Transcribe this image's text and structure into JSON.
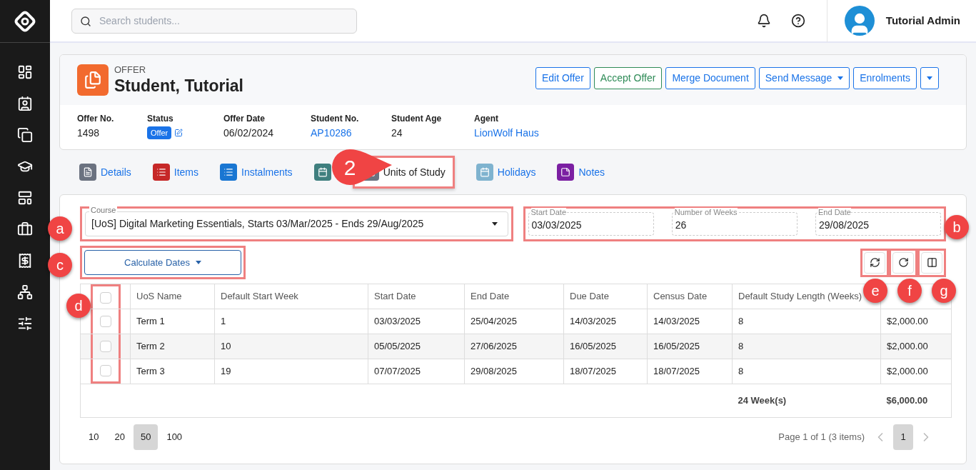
{
  "search": {
    "placeholder": "Search students..."
  },
  "user": {
    "name": "Tutorial Admin"
  },
  "offer": {
    "kind_label": "OFFER",
    "title": "Student, Tutorial",
    "actions": [
      {
        "label": "Edit Offer",
        "kind": "primary"
      },
      {
        "label": "Accept Offer",
        "kind": "success"
      },
      {
        "label": "Merge Document",
        "kind": "primary"
      },
      {
        "label": "Send Message",
        "kind": "dropdown"
      },
      {
        "label": "Enrolments",
        "kind": "primary"
      },
      {
        "kind": "caret"
      }
    ],
    "fields": [
      {
        "label": "Offer No.",
        "value": "1498",
        "kind": "text"
      },
      {
        "label": "Status",
        "value": "Offer",
        "kind": "badge"
      },
      {
        "label": "Offer Date",
        "value": "06/02/2024",
        "kind": "text"
      },
      {
        "label": "Student No.",
        "value": "AP10286",
        "kind": "link"
      },
      {
        "label": "Student Age",
        "value": "24",
        "kind": "text"
      },
      {
        "label": "Agent",
        "value": "LionWolf Haus",
        "kind": "link"
      }
    ]
  },
  "tabs": [
    {
      "label": "Details",
      "color": "#6b7280",
      "selected": false
    },
    {
      "label": "Items",
      "color": "#c62828",
      "selected": false
    },
    {
      "label": "Instalments",
      "color": "#1976d2",
      "selected": false
    },
    {
      "color": "#3f7f7f",
      "selected": false
    },
    {
      "label": "Units of Study",
      "color": "#6b7280",
      "selected": true
    },
    {
      "label": "Holidays",
      "color": "#7fb3cf",
      "selected": false
    },
    {
      "label": "Notes",
      "color": "#7b1fa2",
      "selected": false
    }
  ],
  "course": {
    "label": "Course",
    "value": "[UoS] Digital Marketing Essentials, Starts 03/Mar/2025 - Ends 29/Aug/2025"
  },
  "date_fields": [
    {
      "label": "Start Date",
      "value": "03/03/2025"
    },
    {
      "label": "Number of Weeks",
      "value": "26"
    },
    {
      "label": "End Date",
      "value": "29/08/2025"
    }
  ],
  "calculate_button": {
    "label": "Calculate Dates"
  },
  "table": {
    "header_checked": false,
    "columns": [
      "UoS Name",
      "Default Start Week",
      "Start Date",
      "End Date",
      "Due Date",
      "Census Date",
      "Default Study Length (Weeks)"
    ],
    "rows": [
      {
        "checked": false,
        "cells": [
          "Term 1",
          "1",
          "03/03/2025",
          "25/04/2025",
          "14/03/2025",
          "14/03/2025",
          "8",
          "$2,000.00"
        ]
      },
      {
        "checked": false,
        "cells": [
          "Term 2",
          "10",
          "05/05/2025",
          "27/06/2025",
          "16/05/2025",
          "16/05/2025",
          "8",
          "$2,000.00"
        ]
      },
      {
        "checked": false,
        "cells": [
          "Term 3",
          "19",
          "07/07/2025",
          "29/08/2025",
          "18/07/2025",
          "18/07/2025",
          "8",
          "$2,000.00"
        ]
      }
    ],
    "totals": {
      "weeks": "24 Week(s)",
      "amount": "$6,000.00"
    }
  },
  "pagination": {
    "sizes": [
      {
        "label": "10",
        "selected": false
      },
      {
        "label": "20",
        "selected": false
      },
      {
        "label": "50",
        "selected": true
      },
      {
        "label": "100",
        "selected": false
      }
    ],
    "info": "Page 1 of 1 (3 items)",
    "pages": [
      {
        "label": "1",
        "selected": true
      }
    ]
  },
  "annotations": {
    "step": "2",
    "a": "a",
    "b": "b",
    "c": "c",
    "d": "d",
    "e": "e",
    "f": "f",
    "g": "g"
  }
}
